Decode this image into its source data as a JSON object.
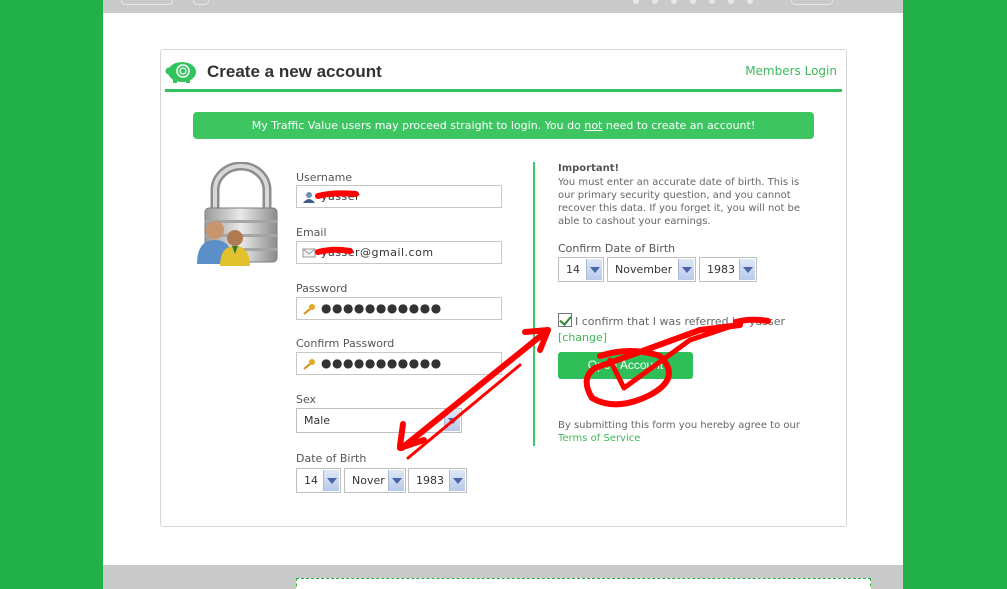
{
  "header": {
    "title": "Create a new account",
    "members_login": "Members Login"
  },
  "notice": {
    "before": "My Traffic Value users may proceed straight to login. You do ",
    "emph": "not",
    "after": " need to create an account!"
  },
  "form": {
    "username": {
      "label": "Username",
      "value": "yasser"
    },
    "email": {
      "label": "Email",
      "value": "yasser@gmail.com"
    },
    "password": {
      "label": "Password",
      "value": "●●●●●●●●●●●"
    },
    "confirm_password": {
      "label": "Confirm Password",
      "value": "●●●●●●●●●●●"
    },
    "sex": {
      "label": "Sex",
      "value": "Male"
    },
    "dob": {
      "label": "Date of Birth",
      "day": "14",
      "month": "Nover",
      "year": "1983"
    }
  },
  "important": {
    "title": "Important!",
    "text": "You must enter an accurate date of birth. This is our primary security question, and you cannot recover this data. If you forget it, you will not be able to cashout your earnings."
  },
  "confirm_dob": {
    "label": "Confirm Date of Birth",
    "day": "14",
    "month": "November",
    "year": "1983"
  },
  "referral": {
    "checked": true,
    "text": "I confirm that I was referred by yasser",
    "change_link": "[change]"
  },
  "submit_button": "Open Account",
  "agreement": {
    "text": "By submitting this form you hereby agree to our",
    "link": "Terms of Service"
  },
  "colors": {
    "brand_green": "#22b04b",
    "accent_green": "#3cc561",
    "annotation_red": "#ff0000"
  }
}
